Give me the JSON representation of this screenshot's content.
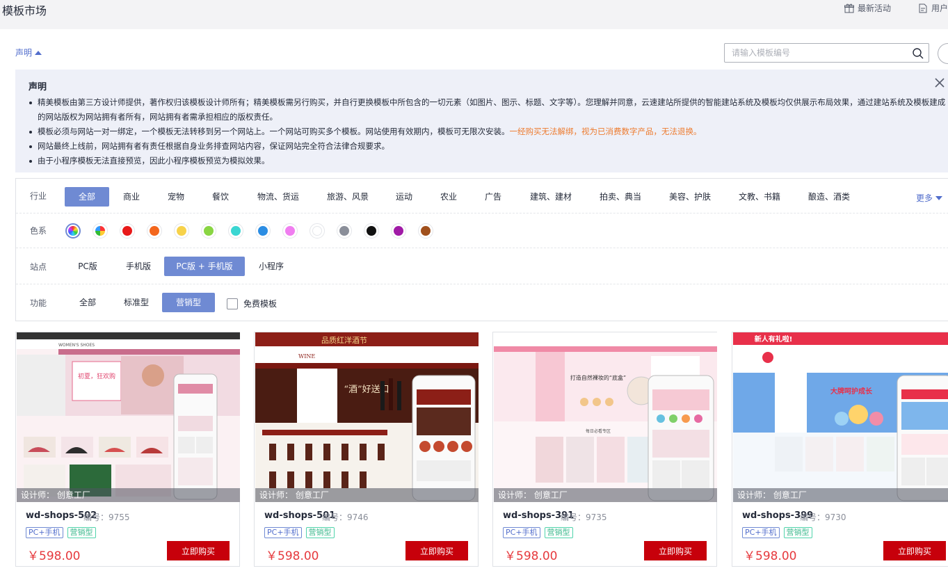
{
  "page": {
    "title": "模板市场"
  },
  "topbar": {
    "activity_label": "最新活动",
    "guide_label": "用户"
  },
  "statement": {
    "toggle_label": "声明",
    "title": "声明",
    "items": [
      "精美模板由第三方设计师提供，著作权归该模板设计师所有；精美模板需另行购买，并自行更换模板中所包含的一切元素（如图片、图示、标题、文字等）。您理解并同意，云速建站所提供的智能建站系统及模板均仅供展示布局效果，通过建站系统及模板建成的网站版权为网站拥有者所有，网站拥有者需承担相应的版权责任。",
      "模板必须与网站一对一绑定，一个模板无法转移到另一个网站上。一个网站可购买多个模板。网站使用有效期内，模板可无限次安装。",
      "网站最终上线前，网站拥有者有责任根据自身业务排查网站内容，保证网站完全符合法律合规要求。",
      "由于小程序模板无法直接预览，因此小程序模板预览为模拟效果。"
    ],
    "warning": "一经购买无法解绑，视为已消费数字产品，无法退换。"
  },
  "search": {
    "placeholder": "请输入模板编号"
  },
  "filters": {
    "industry": {
      "label": "行业",
      "options": [
        "全部",
        "商业",
        "宠物",
        "餐饮",
        "物流、货运",
        "旅游、风景",
        "运动",
        "农业",
        "广告",
        "建筑、建材",
        "拍卖、典当",
        "美容、护肤",
        "文教、书籍",
        "酿造、酒类"
      ],
      "selected": "全部",
      "more_label": "更多"
    },
    "color": {
      "label": "色系",
      "swatches": [
        "conic-gradient(#e33,#fd3,#3c3,#3cf,#36f,#c3f,#e33)",
        "conic-gradient(#f33 0 25%,#fc3 0 50%,#3b3 0 75%,#39f 0)",
        "#e81919",
        "#f3661d",
        "#f7d24a",
        "#89d543",
        "#3ad6d2",
        "#2b8de3",
        "#f07ef0",
        "#ffffff",
        "#8a8e99",
        "#111111",
        "#a01aa6",
        "#a0501c"
      ],
      "selected_index": 0
    },
    "site": {
      "label": "站点",
      "options": [
        "PC版",
        "手机版",
        "PC版 + 手机版",
        "小程序"
      ],
      "selected": "PC版 + 手机版"
    },
    "function": {
      "label": "功能",
      "options": [
        "全部",
        "标准型",
        "营销型"
      ],
      "selected": "营销型",
      "free_label": "免费模板"
    }
  },
  "cards": [
    {
      "designer": "设计师：  创意工厂",
      "name": "wd-shops-502",
      "number": "编号：9755",
      "tags": [
        "PC+手机",
        "营销型"
      ],
      "price": "￥598.00",
      "buy_label": "立即购买",
      "theme": "#e9a3b8"
    },
    {
      "designer": "设计师：  创意工厂",
      "name": "wd-shops-501",
      "number": "编号：9746",
      "tags": [
        "PC+手机",
        "营销型"
      ],
      "price": "￥598.00",
      "buy_label": "立即购买",
      "theme": "#8c1f17"
    },
    {
      "designer": "设计师：  创意工厂",
      "name": "wd-shops-391",
      "number": "编号：9735",
      "tags": [
        "PC+手机",
        "营销型"
      ],
      "price": "￥598.00",
      "buy_label": "立即购买",
      "theme": "#f08aa6"
    },
    {
      "designer": "设计师：  创意工厂",
      "name": "wd-shops-399",
      "number": "编号：9730",
      "tags": [
        "PC+手机",
        "营销型"
      ],
      "price": "￥598.00",
      "buy_label": "立即购买",
      "theme": "#e8304a"
    }
  ],
  "thumb_texts": {
    "card1_banner": "初夏，狂欢购",
    "card1_logo": "WOMEN'S SHOES",
    "card2_banner": "品质红洋酒节",
    "card2_slogan": "“酒”好送口",
    "card2_logo": "WINE",
    "card3_banner": "打造自然裸妆的“底盒”",
    "card3_section": "每日必看专区",
    "card4_banner": "新人有礼啦!",
    "card4_slogan": "大牌呵护成长"
  }
}
